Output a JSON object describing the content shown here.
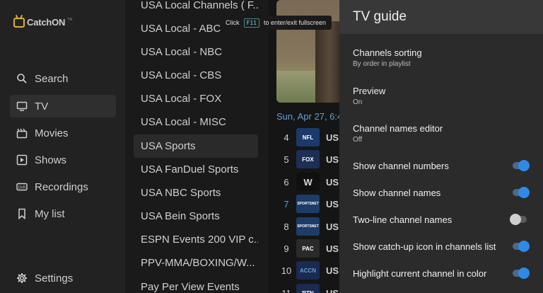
{
  "nav": {
    "logo_text": "CatchON",
    "logo_tm": "TM",
    "items": [
      {
        "label": "Search"
      },
      {
        "label": "TV"
      },
      {
        "label": "Movies"
      },
      {
        "label": "Shows"
      },
      {
        "label": "Recordings"
      },
      {
        "label": "My list"
      }
    ],
    "settings_label": "Settings"
  },
  "groups": [
    "USA Local Channels ( F...",
    "USA Local - ABC",
    "USA Local - NBC",
    "USA Local - CBS",
    "USA Local - FOX",
    "USA Local - MISC",
    "USA Sports",
    "USA FanDuel Sports",
    "USA NBC Sports",
    "USA Bein Sports",
    "ESPN Events 200 VIP c...",
    "PPV-MMA/BOXING/W...",
    "Pay Per View Events"
  ],
  "hint": {
    "prefix": "Click",
    "key": "F11",
    "suffix": "to enter/exit fullscreen"
  },
  "epg": {
    "date": "Sun, Apr 27, 6:4",
    "channels": [
      {
        "num": "4",
        "name": "US",
        "logo": "NFL",
        "color": "#1b3a6b"
      },
      {
        "num": "5",
        "name": "US",
        "logo": "FOX",
        "color": "#1c2f55"
      },
      {
        "num": "6",
        "name": "US",
        "logo": "W",
        "color": "#101010"
      },
      {
        "num": "7",
        "name": "US",
        "logo": "SPORTSNET",
        "color": "#1d3d68"
      },
      {
        "num": "8",
        "name": "US",
        "logo": "SPORTSNET",
        "color": "#1d3d68"
      },
      {
        "num": "9",
        "name": "US",
        "logo": "PAC",
        "color": "#2a2a2a"
      },
      {
        "num": "10",
        "name": "US",
        "logo": "ACCN",
        "color": "#1a2a50"
      },
      {
        "num": "11",
        "name": "US",
        "logo": "BTN",
        "color": "#1a2a50"
      }
    ]
  },
  "panel": {
    "title": "TV guide",
    "sorting": {
      "title": "Channels sorting",
      "value": "By order in playlist"
    },
    "preview": {
      "title": "Preview",
      "value": "On"
    },
    "names_editor": {
      "title": "Channel names editor",
      "value": "Off"
    },
    "toggles": [
      {
        "label": "Show channel numbers",
        "on": true
      },
      {
        "label": "Show channel names",
        "on": true
      },
      {
        "label": "Two-line channel names",
        "on": false
      },
      {
        "label": "Show catch-up icon in channels list",
        "on": true
      },
      {
        "label": "Highlight current channel in color",
        "on": true
      }
    ]
  }
}
